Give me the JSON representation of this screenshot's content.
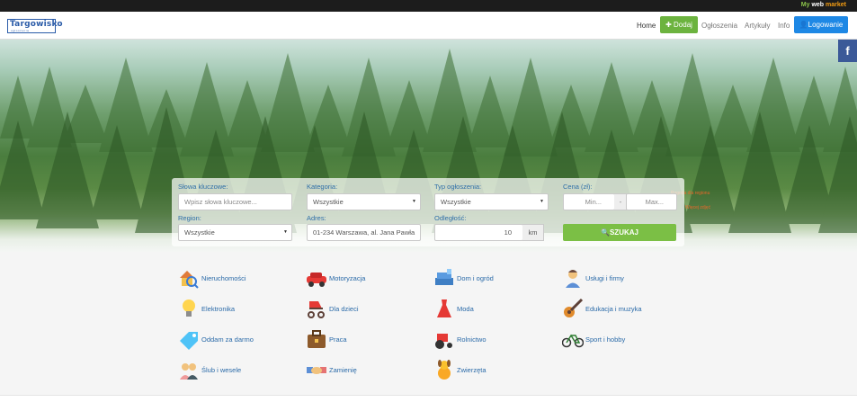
{
  "topbar": {
    "brand_left": "My ",
    "brand_mid": "web ",
    "brand_right": "market"
  },
  "logo": {
    "title": "Targowisko",
    "subtitle": "ogłoszenia"
  },
  "nav": {
    "home": "Home",
    "add": "Dodaj",
    "ads": "Ogłoszenia",
    "articles": "Artykuły",
    "info": "Info",
    "login": "Logowanie"
  },
  "hero": {
    "facebook": "f",
    "link1": "Pogoda dla regionu",
    "link2": "Więcej zdjęć"
  },
  "search": {
    "keywords_label": "Słowa kluczowe:",
    "keywords_placeholder": "Wpisz słowa kluczowe...",
    "category_label": "Kategoria:",
    "category_value": "Wszystkie",
    "type_label": "Typ ogłoszenia:",
    "type_value": "Wszystkie",
    "price_label": "Cena (zł):",
    "price_min": "Min...",
    "price_sep": "-",
    "price_max": "Max...",
    "region_label": "Region:",
    "region_value": "Wszystkie",
    "address_label": "Adres:",
    "address_value": "01-234 Warszawa, al. Jana Pawła",
    "distance_label": "Odległość:",
    "distance_value": "10",
    "distance_unit": "km",
    "submit": "SZUKAJ"
  },
  "categories": [
    {
      "label": "Nieruchomości",
      "icon": "house-magnifier-icon"
    },
    {
      "label": "Motoryzacja",
      "icon": "car-icon"
    },
    {
      "label": "Dom i ogród",
      "icon": "sofa-icon"
    },
    {
      "label": "Usługi i firmy",
      "icon": "businessman-icon"
    },
    {
      "label": "Elektronika",
      "icon": "lightbulb-icon"
    },
    {
      "label": "Dla dzieci",
      "icon": "stroller-icon"
    },
    {
      "label": "Moda",
      "icon": "dress-icon"
    },
    {
      "label": "Edukacja i muzyka",
      "icon": "guitar-icon"
    },
    {
      "label": "Oddam za darmo",
      "icon": "tag-icon"
    },
    {
      "label": "Praca",
      "icon": "briefcase-icon"
    },
    {
      "label": "Rolnictwo",
      "icon": "tractor-icon"
    },
    {
      "label": "Sport i hobby",
      "icon": "bicycle-icon"
    },
    {
      "label": "Ślub i wesele",
      "icon": "couple-icon"
    },
    {
      "label": "Zamienię",
      "icon": "handshake-icon"
    },
    {
      "label": "Zwierzęta",
      "icon": "dog-icon"
    }
  ],
  "colors": {
    "accent_green": "#6cb33f",
    "accent_blue": "#1e88e5",
    "link_blue": "#2a6aa8",
    "facebook": "#3b5998"
  }
}
